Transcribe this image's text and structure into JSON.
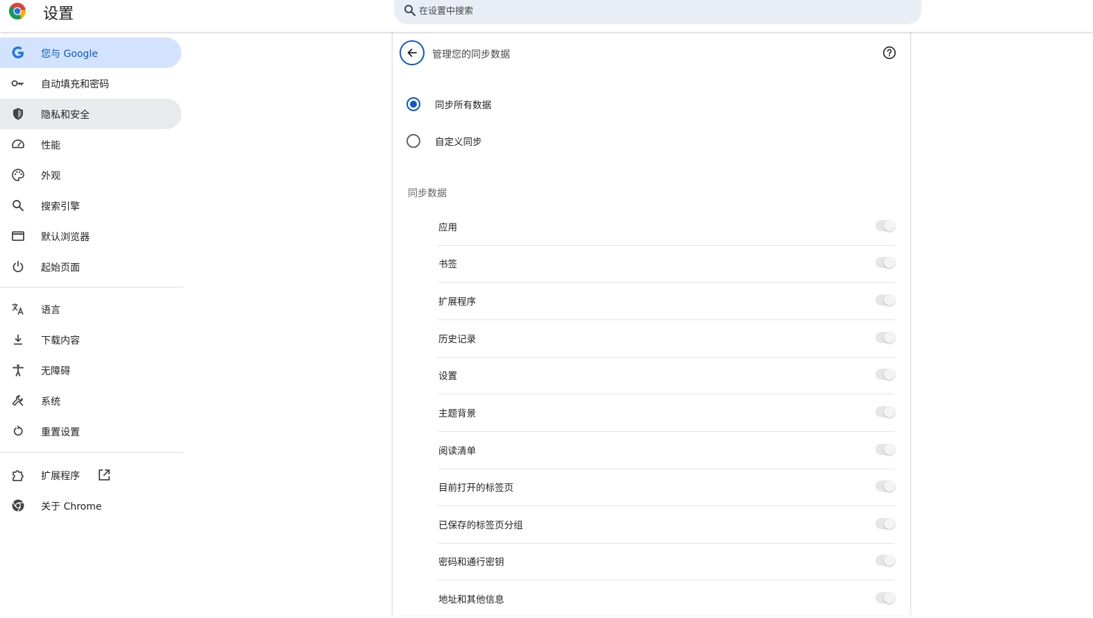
{
  "header": {
    "title": "设置",
    "search_placeholder": "在设置中搜索"
  },
  "sidebar": {
    "items": [
      {
        "label": "您与 Google",
        "icon": "google-icon"
      },
      {
        "label": "自动填充和密码",
        "icon": "key-icon"
      },
      {
        "label": "隐私和安全",
        "icon": "shield-icon"
      },
      {
        "label": "性能",
        "icon": "speedometer-icon"
      },
      {
        "label": "外观",
        "icon": "palette-icon"
      },
      {
        "label": "搜索引擎",
        "icon": "search-icon"
      },
      {
        "label": "默认浏览器",
        "icon": "browser-window-icon"
      },
      {
        "label": "起始页面",
        "icon": "power-icon"
      },
      {
        "label": "语言",
        "icon": "translate-icon"
      },
      {
        "label": "下载内容",
        "icon": "download-icon"
      },
      {
        "label": "无障碍",
        "icon": "accessibility-icon"
      },
      {
        "label": "系统",
        "icon": "wrench-icon"
      },
      {
        "label": "重置设置",
        "icon": "reset-icon"
      },
      {
        "label": "扩展程序",
        "icon": "puzzle-icon"
      },
      {
        "label": "关于 Chrome",
        "icon": "chrome-icon"
      }
    ]
  },
  "main": {
    "title": "管理您的同步数据",
    "radio_options": [
      {
        "label": "同步所有数据",
        "checked": true
      },
      {
        "label": "自定义同步",
        "checked": false
      }
    ],
    "section_title": "同步数据",
    "sync_items": [
      {
        "label": "应用",
        "enabled": true
      },
      {
        "label": "书签",
        "enabled": true
      },
      {
        "label": "扩展程序",
        "enabled": true
      },
      {
        "label": "历史记录",
        "enabled": true
      },
      {
        "label": "设置",
        "enabled": true
      },
      {
        "label": "主题背景",
        "enabled": true
      },
      {
        "label": "阅读清单",
        "enabled": true
      },
      {
        "label": "目前打开的标签页",
        "enabled": true
      },
      {
        "label": "已保存的标签页分组",
        "enabled": true
      },
      {
        "label": "密码和通行密钥",
        "enabled": true
      },
      {
        "label": "地址和其他信息",
        "enabled": true
      }
    ]
  },
  "colors": {
    "accent": "#0b57d0",
    "active_nav_bg": "#d3e3fd",
    "search_bg": "#e9eef6"
  }
}
